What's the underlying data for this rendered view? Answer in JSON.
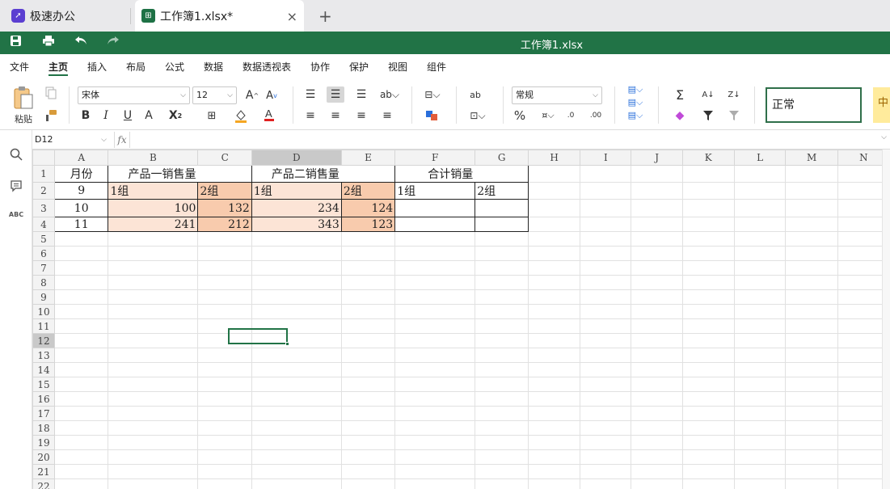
{
  "tabs": {
    "home_label": "极速办公",
    "doc_label": "工作簿1.xlsx*",
    "new_tab": "+",
    "close": "×"
  },
  "titlebar": {
    "title": "工作簿1.xlsx"
  },
  "menu": [
    "文件",
    "主页",
    "插入",
    "布局",
    "公式",
    "数据",
    "数据透视表",
    "协作",
    "保护",
    "视图",
    "组件"
  ],
  "ribbon": {
    "paste_label": "粘贴",
    "font_name": "宋体",
    "font_size": "12",
    "number_format": "常规",
    "style_normal": "正常",
    "style_mid": "中"
  },
  "formula": {
    "cell_ref": "D12",
    "fx": "fx",
    "value": ""
  },
  "sheet": {
    "columns": [
      "A",
      "B",
      "C",
      "D",
      "E",
      "F",
      "G",
      "H",
      "I",
      "J",
      "K",
      "L",
      "M",
      "N"
    ],
    "selected_cell": "D12",
    "rows": [
      [
        "月份",
        "产品一销售量",
        "",
        "产品二销售量",
        "",
        "合计销量",
        ""
      ],
      [
        "9",
        "1组",
        "2组",
        "1组",
        "2组",
        "1组",
        "2组"
      ],
      [
        "10",
        "100",
        "132",
        "234",
        "124",
        "",
        ""
      ],
      [
        "11",
        "241",
        "212",
        "343",
        "123",
        "",
        ""
      ]
    ],
    "row_count": 22
  },
  "colors": {
    "accent": "#217346",
    "fill_light": "#fce4d6",
    "fill_dark": "#f8cbad"
  }
}
